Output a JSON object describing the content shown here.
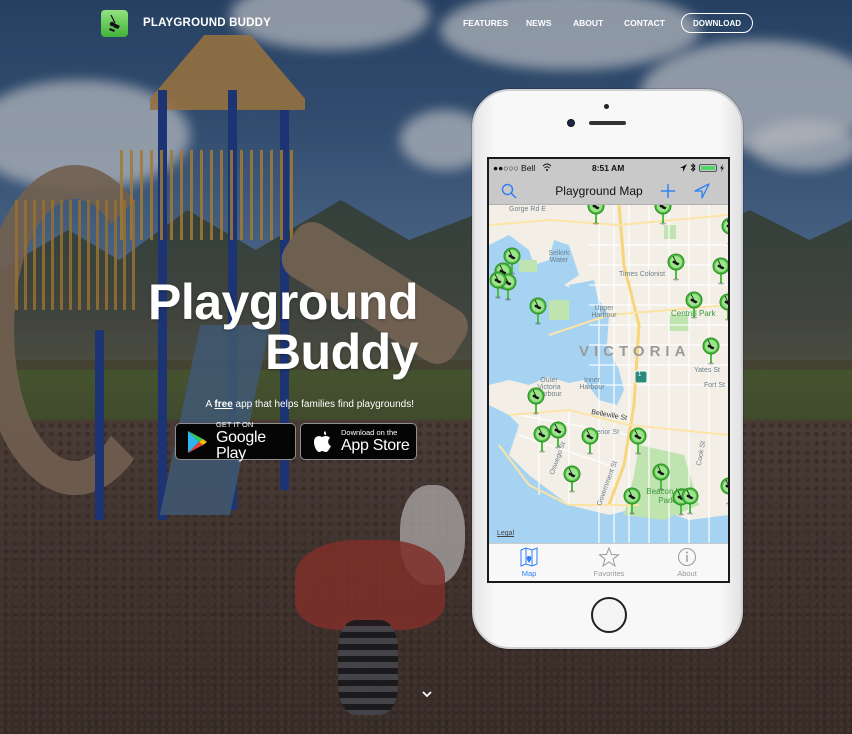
{
  "nav": {
    "brand": "PLAYGROUND BUDDY",
    "logo_icon": "swing-icon",
    "links": [
      "FEATURES",
      "NEWS",
      "ABOUT",
      "CONTACT"
    ],
    "download_label": "DOWNLOAD"
  },
  "hero": {
    "title_line1": "Playground",
    "title_line2": "Buddy",
    "tagline_prefix": "A",
    "tagline_emphasis": "free",
    "tagline_suffix": "app that helps families find playgrounds!",
    "google_play": {
      "small": "GET IT ON",
      "big": "Google Play"
    },
    "app_store": {
      "small": "Download on the",
      "big": "App Store"
    },
    "scroll_icon": "chevron-down-icon"
  },
  "phone": {
    "status": {
      "carrier": "●●○○○ Bell",
      "time": "8:51 AM",
      "battery_percent": 100
    },
    "navbar": {
      "title": "Playground Map"
    },
    "map": {
      "labels": {
        "street1": "Gorge Rd E",
        "water1": "Selkirk Water",
        "poi1": "Times Colonist",
        "water2": "Upper Harbour",
        "park1": "Central Park",
        "city": "VICTORIA",
        "street2": "Yates St",
        "street3": "Fort St",
        "water3": "Outer Victoria Harbour",
        "water4": "Inner Harbour",
        "street4": "Belleville St",
        "street5": "Superior St",
        "street6": "Oswego St",
        "street7": "Government St",
        "street8": "Cook St",
        "park2": "Beacon Hill Park",
        "highway": "1",
        "legal": "Legal"
      }
    },
    "tabs": [
      {
        "label": "Map",
        "icon": "map-icon",
        "active": true
      },
      {
        "label": "Favorites",
        "icon": "star-icon",
        "active": false
      },
      {
        "label": "About",
        "icon": "info-icon",
        "active": false
      }
    ]
  },
  "colors": {
    "accent_blue": "#2d7ef7",
    "pin_green": "#4cbf3f",
    "logo_green": "#5cc84a"
  }
}
